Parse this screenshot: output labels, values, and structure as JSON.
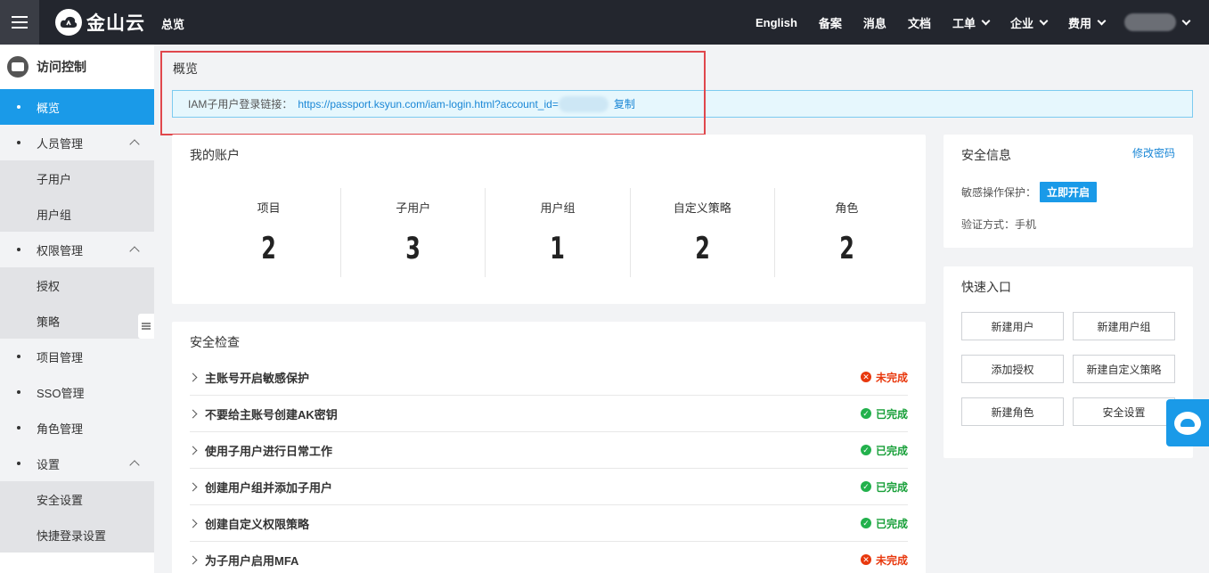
{
  "topbar": {
    "brand": "金山云",
    "overview": "总览",
    "nav": [
      {
        "label": "English",
        "dropdown": false
      },
      {
        "label": "备案",
        "dropdown": false
      },
      {
        "label": "消息",
        "dropdown": false
      },
      {
        "label": "文档",
        "dropdown": false
      },
      {
        "label": "工单",
        "dropdown": true
      },
      {
        "label": "企业",
        "dropdown": true
      },
      {
        "label": "费用",
        "dropdown": true
      }
    ]
  },
  "sidebar": {
    "title": "访问控制",
    "items": [
      {
        "label": "概览",
        "active": true
      },
      {
        "label": "人员管理",
        "expandable": true
      },
      {
        "label": "子用户",
        "sub": true
      },
      {
        "label": "用户组",
        "sub": true
      },
      {
        "label": "权限管理",
        "expandable": true
      },
      {
        "label": "授权",
        "sub": true
      },
      {
        "label": "策略",
        "sub": true
      },
      {
        "label": "项目管理"
      },
      {
        "label": "SSO管理"
      },
      {
        "label": "角色管理"
      },
      {
        "label": "设置",
        "expandable": true
      },
      {
        "label": "安全设置",
        "sub": true
      },
      {
        "label": "快捷登录设置",
        "sub": true
      }
    ]
  },
  "page": {
    "title": "概览",
    "iam_label": "IAM子用户登录链接：",
    "iam_link": "https://passport.ksyun.com/iam-login.html?account_id=",
    "copy": "复制"
  },
  "account": {
    "title": "我的账户",
    "stats": [
      {
        "label": "项目",
        "value": "2"
      },
      {
        "label": "子用户",
        "value": "3"
      },
      {
        "label": "用户组",
        "value": "1"
      },
      {
        "label": "自定义策略",
        "value": "2"
      },
      {
        "label": "角色",
        "value": "2"
      }
    ]
  },
  "security_check": {
    "title": "安全检查",
    "items": [
      {
        "label": "主账号开启敏感保护",
        "status": "未完成",
        "done": false
      },
      {
        "label": "不要给主账号创建AK密钥",
        "status": "已完成",
        "done": true
      },
      {
        "label": "使用子用户进行日常工作",
        "status": "已完成",
        "done": true
      },
      {
        "label": "创建用户组并添加子用户",
        "status": "已完成",
        "done": true
      },
      {
        "label": "创建自定义权限策略",
        "status": "已完成",
        "done": true
      },
      {
        "label": "为子用户启用MFA",
        "status": "未完成",
        "done": false
      }
    ]
  },
  "security_info": {
    "title": "安全信息",
    "edit_password": "修改密码",
    "sensitive_label": "敏感操作保护：",
    "enable_now": "立即开启",
    "verify": "验证方式：手机"
  },
  "quick": {
    "title": "快速入口",
    "buttons": [
      "新建用户",
      "新建用户组",
      "添加授权",
      "新建自定义策略",
      "新建角色",
      "安全设置"
    ]
  },
  "colors": {
    "accent": "#1a9ae8",
    "topbar": "#23262e",
    "done": "#22b14c",
    "todo": "#e8380d",
    "highlight": "#e0474c"
  }
}
